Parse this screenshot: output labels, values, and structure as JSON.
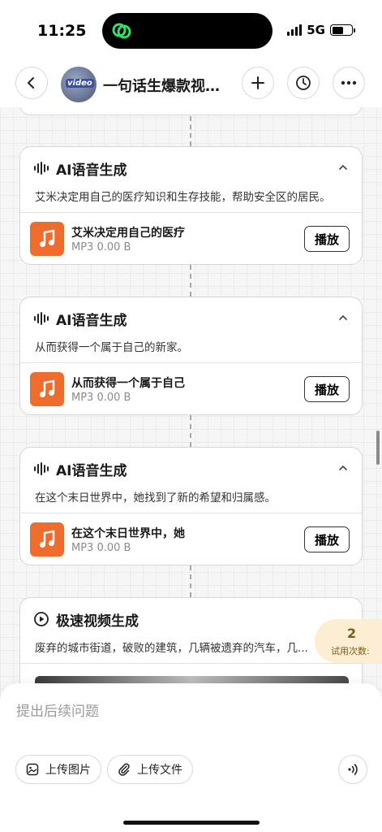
{
  "status_bar": {
    "time": "11:25",
    "network": "5G"
  },
  "header": {
    "title": "一句话生爆款视频-...",
    "avatar_text": "video"
  },
  "cards": [
    {
      "title": "AI语音生成",
      "description": "艾米决定用自己的医疗知识和生存技能，帮助安全区的居民。",
      "audio": {
        "name": "艾米决定用自己的医疗",
        "meta": "MP3 0.00 B",
        "play_label": "播放"
      }
    },
    {
      "title": "AI语音生成",
      "description": "从而获得一个属于自己的新家。",
      "audio": {
        "name": "从而获得一个属于自己",
        "meta": "MP3 0.00 B",
        "play_label": "播放"
      }
    },
    {
      "title": "AI语音生成",
      "description": "在这个末日世界中，她找到了新的希望和归属感。",
      "audio": {
        "name": "在这个末日世界中，她",
        "meta": "MP3 0.00 B",
        "play_label": "播放"
      }
    }
  ],
  "video_card": {
    "title": "极速视频生成",
    "description": "废弃的城市街道，破败的建筑，几辆被遗弃的汽车，几..."
  },
  "trial": {
    "count": "2",
    "label": "试用次数:"
  },
  "input": {
    "placeholder": "提出后续问题",
    "upload_image": "上传图片",
    "upload_file": "上传文件"
  },
  "colors": {
    "accent_orange": "#ef6c2c",
    "trial_bg": "#fbeed3"
  }
}
